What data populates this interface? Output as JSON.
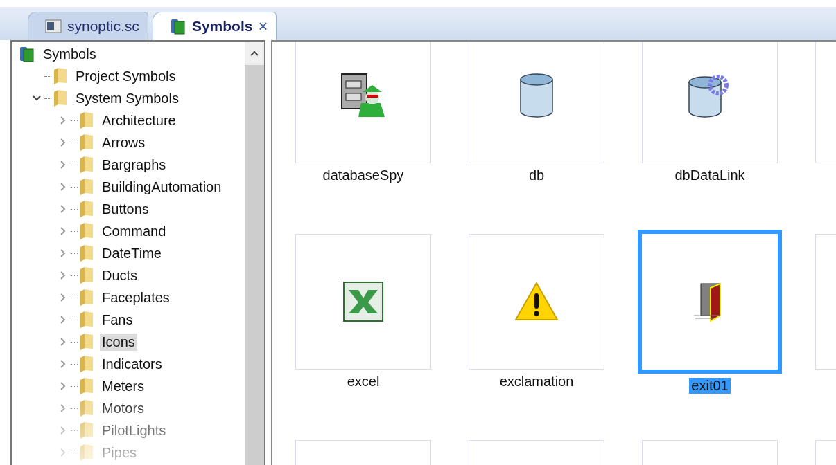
{
  "tabs": [
    {
      "label": "synoptic.sc",
      "kind": "screen",
      "selected": false
    },
    {
      "label": "Symbols",
      "kind": "library",
      "selected": true,
      "close": "×"
    }
  ],
  "tree": {
    "label": "Symbols",
    "selected": false,
    "children": [
      {
        "label": "Project Symbols",
        "selected": false
      },
      {
        "label": "System Symbols",
        "expanded": true,
        "selected": false,
        "children": [
          {
            "label": "Architecture",
            "expanded": false,
            "selected": false
          },
          {
            "label": "Arrows",
            "expanded": false,
            "selected": false
          },
          {
            "label": "Bargraphs",
            "expanded": false,
            "selected": false
          },
          {
            "label": "BuildingAutomation",
            "expanded": false,
            "selected": false
          },
          {
            "label": "Buttons",
            "expanded": false,
            "selected": false
          },
          {
            "label": "Command",
            "expanded": false,
            "selected": false
          },
          {
            "label": "DateTime",
            "expanded": false,
            "selected": false
          },
          {
            "label": "Ducts",
            "expanded": false,
            "selected": false
          },
          {
            "label": "Faceplates",
            "expanded": false,
            "selected": false
          },
          {
            "label": "Fans",
            "expanded": false,
            "selected": false
          },
          {
            "label": "Icons",
            "expanded": false,
            "selected": true
          },
          {
            "label": "Indicators",
            "expanded": false,
            "selected": false
          },
          {
            "label": "Meters",
            "expanded": false,
            "selected": false
          },
          {
            "label": "Motors",
            "expanded": false,
            "selected": false
          },
          {
            "label": "PilotLights",
            "expanded": false,
            "selected": false
          },
          {
            "label": "Pipes",
            "expanded": false,
            "selected": false
          }
        ]
      }
    ]
  },
  "symbols": [
    {
      "label": "databaseSpy",
      "kind": "spy",
      "selected": false
    },
    {
      "label": "db",
      "kind": "cylinder",
      "selected": false
    },
    {
      "label": "dbDataLink",
      "kind": "cylinder-gear",
      "selected": false
    },
    {
      "kind": "blank",
      "selected": false
    },
    {
      "label": "excel",
      "kind": "spreadsheet",
      "selected": false
    },
    {
      "label": "exclamation",
      "kind": "warning",
      "selected": false
    },
    {
      "label": "exit01",
      "kind": "door",
      "selected": true
    },
    {
      "kind": "blank",
      "selected": false
    },
    {
      "kind": "blank",
      "selected": false
    },
    {
      "kind": "blank",
      "selected": false
    },
    {
      "kind": "blank",
      "selected": false
    },
    {
      "kind": "blank",
      "selected": false
    }
  ]
}
